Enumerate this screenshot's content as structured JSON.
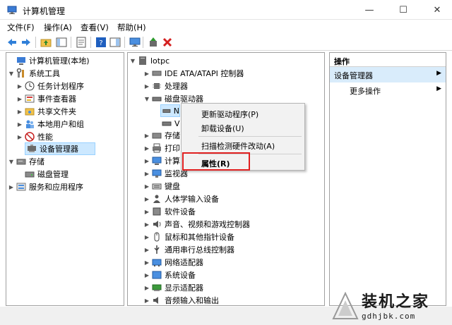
{
  "window": {
    "title": "计算机管理",
    "min_label": "—",
    "max_label": "☐",
    "close_label": "✕"
  },
  "menu": [
    "文件(F)",
    "操作(A)",
    "查看(V)",
    "帮助(H)"
  ],
  "left_tree": [
    "计算机管理(本地)",
    "系统工具",
    "任务计划程序",
    "事件查看器",
    "共享文件夹",
    "本地用户和组",
    "性能",
    "设备管理器",
    "存储",
    "磁盘管理",
    "服务和应用程序"
  ],
  "device_tree": [
    "lotpc",
    "IDE ATA/ATAPI 控制器",
    "处理器",
    "磁盘驱动器",
    "N",
    "V",
    "存储",
    "打印",
    "计算",
    "监视器",
    "键盘",
    "人体学输入设备",
    "软件设备",
    "声音、视频和游戏控制器",
    "鼠标和其他指针设备",
    "通用串行总线控制器",
    "网络适配器",
    "系统设备",
    "显示适配器",
    "音频输入和输出"
  ],
  "context_menu": [
    "更新驱动程序(P)",
    "卸载设备(U)",
    "扫描检测硬件改动(A)",
    "属性(R)"
  ],
  "actions": {
    "header": "操作",
    "section": "设备管理器",
    "more": "更多操作",
    "arrow": "▶"
  },
  "watermark": {
    "text": "装机之家",
    "url": "gdhjbk.com"
  },
  "colors": {
    "selection": "#cce8ff",
    "highlight_box": "#e02020",
    "action_section": "#d9ecfb"
  }
}
